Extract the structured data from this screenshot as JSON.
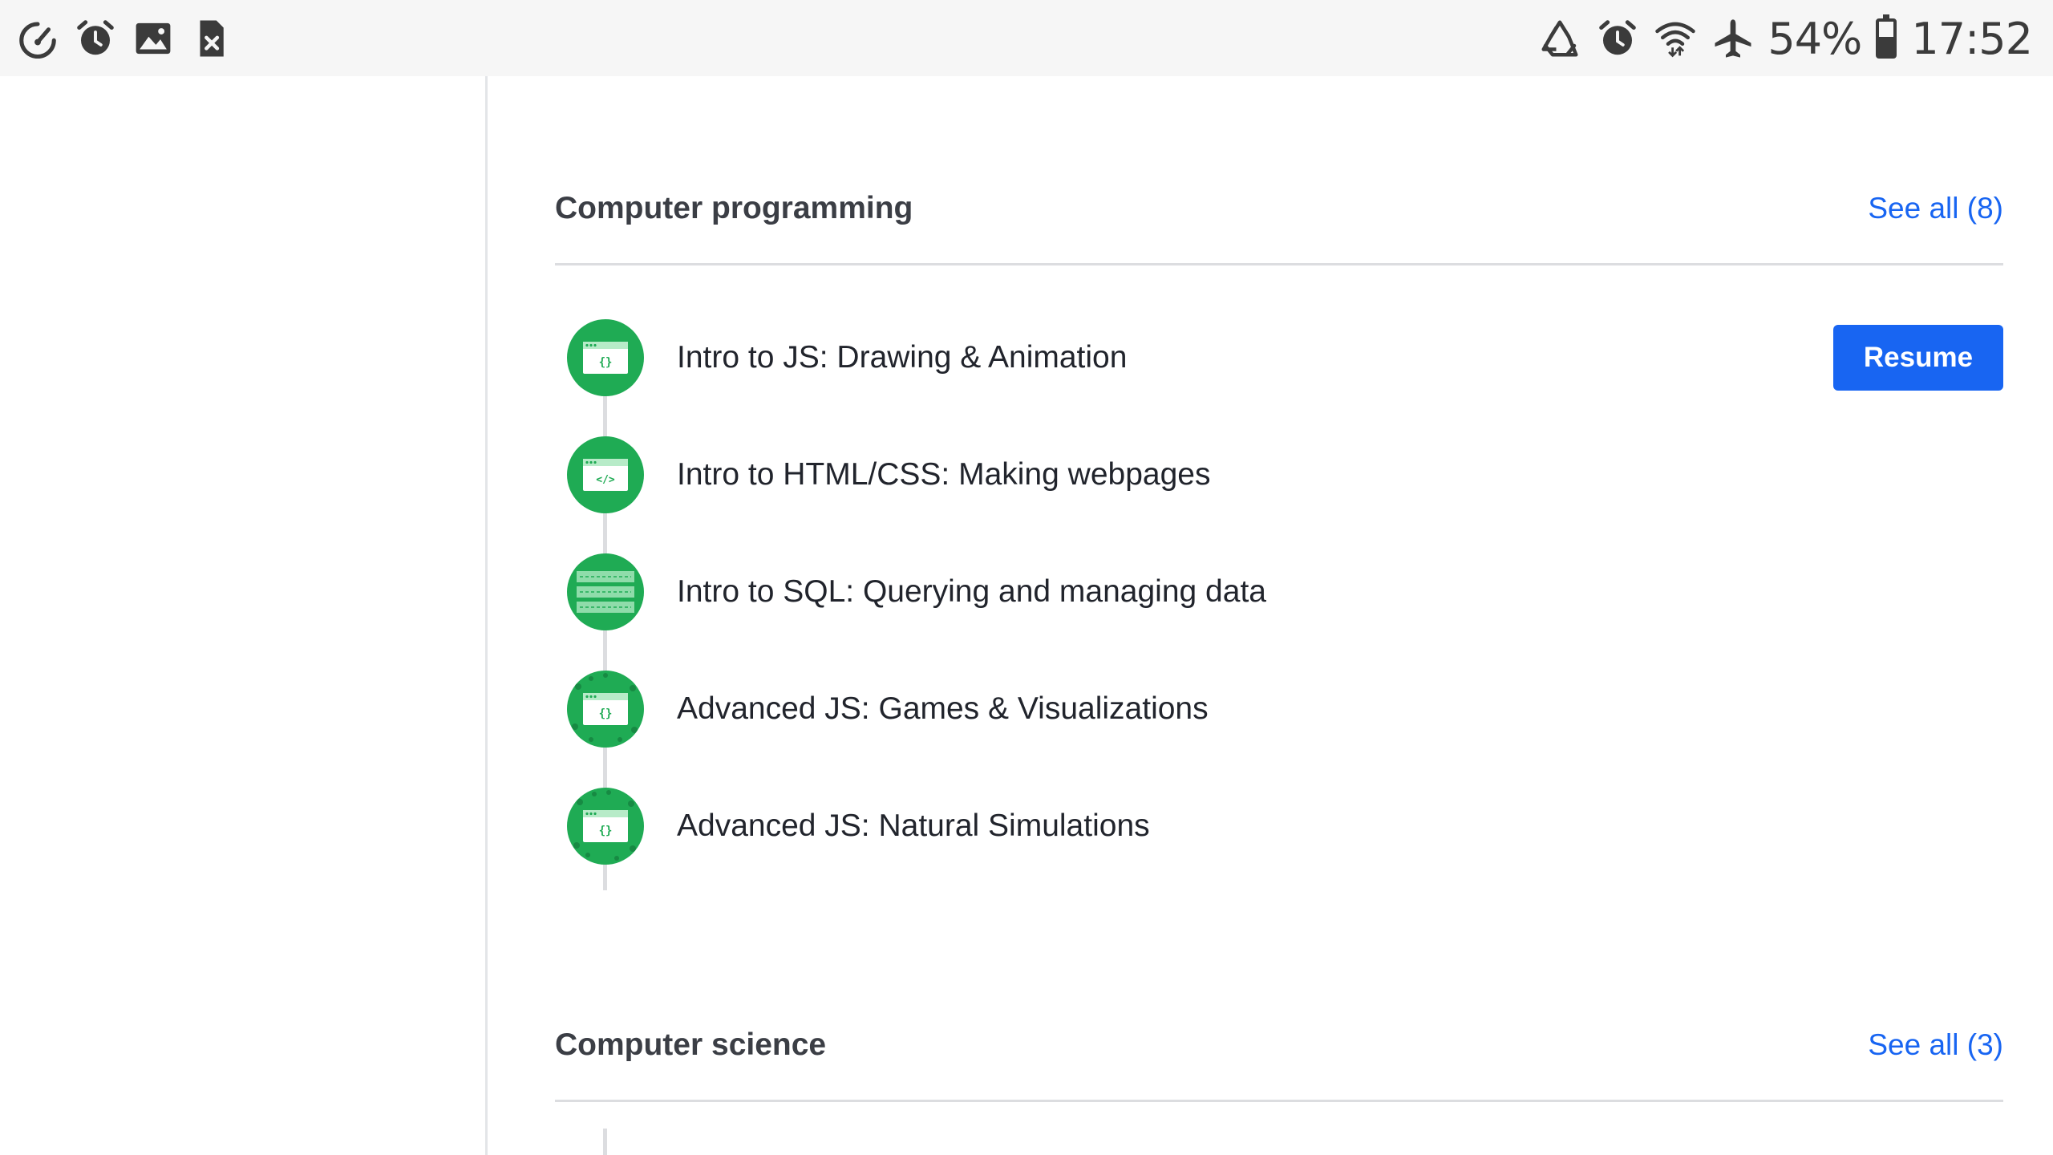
{
  "status_bar": {
    "left_icons": [
      "speedometer-icon",
      "alarm-icon",
      "image-icon",
      "sim-missing-icon"
    ],
    "right_icons": [
      "recycle-icon",
      "alarm-icon",
      "wifi-icon",
      "airplane-mode-icon",
      "battery-icon"
    ],
    "battery_percent": "54%",
    "battery_level": 0.54,
    "time": "17:52"
  },
  "sections": [
    {
      "title": "Computer programming",
      "see_all": "See all (8)",
      "courses": [
        {
          "label": "Intro to JS: Drawing & Animation",
          "icon": "code-braces-icon",
          "action": "Resume"
        },
        {
          "label": "Intro to HTML/CSS: Making webpages",
          "icon": "code-tag-icon"
        },
        {
          "label": "Intro to SQL: Querying and managing data",
          "icon": "database-icon"
        },
        {
          "label": "Advanced JS: Games & Visualizations",
          "icon": "code-braces-icon"
        },
        {
          "label": "Advanced JS: Natural Simulations",
          "icon": "code-braces-icon"
        }
      ]
    },
    {
      "title": "Computer science",
      "see_all": "See all (3)"
    }
  ],
  "colors": {
    "accent_blue": "#1865f2",
    "course_green": "#1fab54",
    "status_bar_bg": "#f6f6f6",
    "divider": "#dcdde0"
  }
}
